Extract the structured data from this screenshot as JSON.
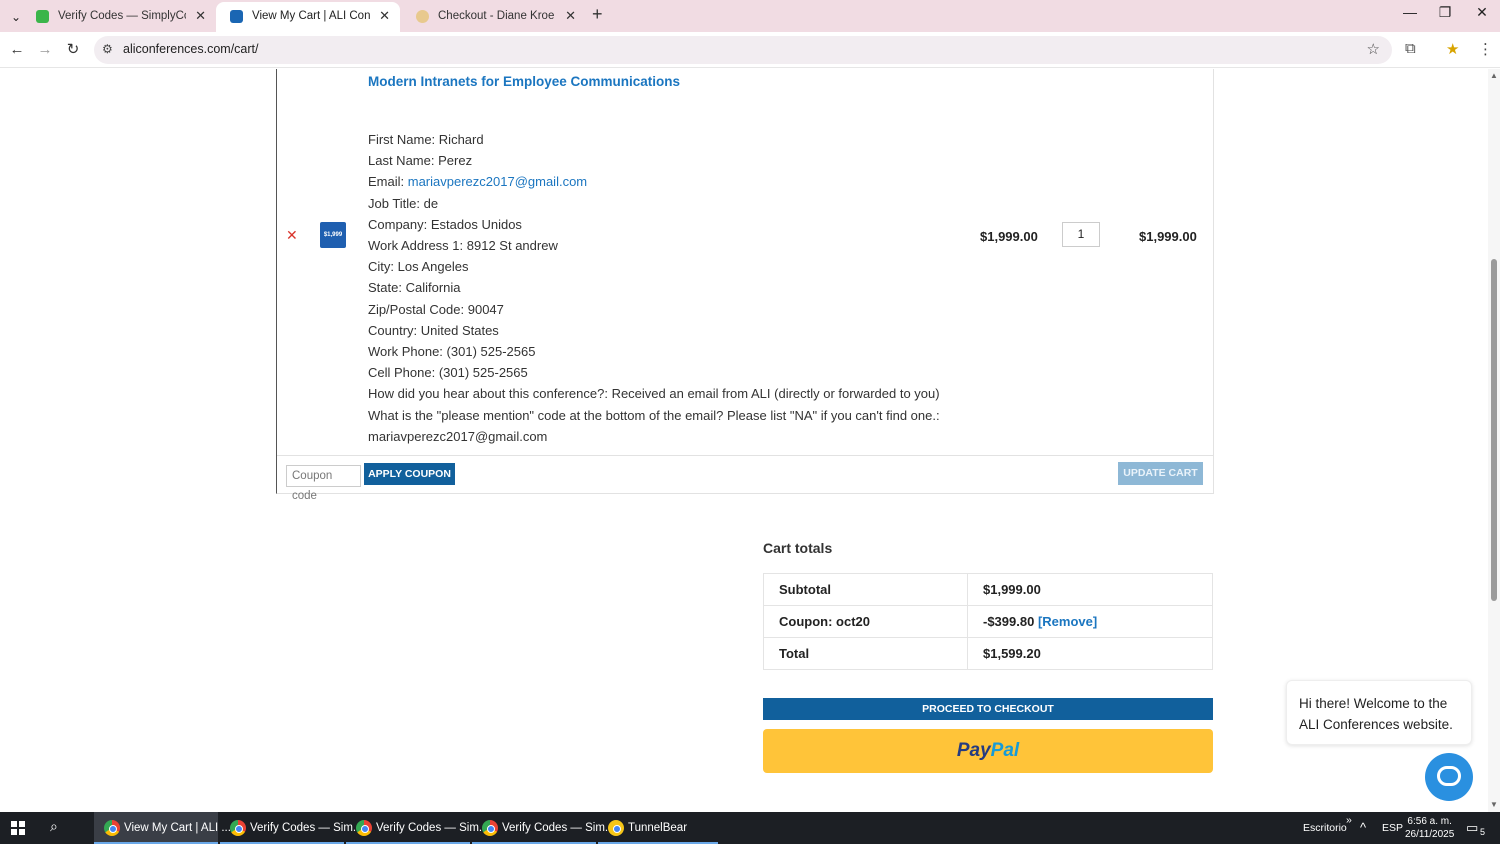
{
  "browser": {
    "tabs": [
      {
        "title": "Verify Codes — SimplyCodes",
        "active": false
      },
      {
        "title": "View My Cart | ALI Conferences",
        "active": true
      },
      {
        "title": "Checkout - Diane Kroe",
        "active": false
      }
    ],
    "url": "aliconferences.com/cart/"
  },
  "cart": {
    "item": {
      "thumb_label": "$1,999",
      "title": "Modern Intranets for Employee Communications",
      "fields": [
        {
          "label": "First Name:",
          "value": "Richard"
        },
        {
          "label": "Last Name:",
          "value": "Perez"
        },
        {
          "label": "Email:",
          "value": "mariavperezc2017@gmail.com",
          "link": true
        },
        {
          "label": "Job Title:",
          "value": "de"
        },
        {
          "label": "Company:",
          "value": "Estados Unidos"
        },
        {
          "label": "Work Address 1:",
          "value": "8912 St andrew"
        },
        {
          "label": "City:",
          "value": "Los Angeles"
        },
        {
          "label": "State:",
          "value": "California"
        },
        {
          "label": "Zip/Postal Code:",
          "value": "90047"
        },
        {
          "label": "Country:",
          "value": "United States"
        },
        {
          "label": "Work Phone:",
          "value": "(301) 525-2565"
        },
        {
          "label": "Cell Phone:",
          "value": "(301) 525-2565"
        },
        {
          "label": "How did you hear about this conference?:",
          "value": "Received an email from ALI (directly or forwarded to you)"
        },
        {
          "label": "What is the \"please mention\" code at the bottom of the email? Please list \"NA\" if you can't find one.:",
          "value": ""
        },
        {
          "label": "",
          "value": "mariavperezc2017@gmail.com"
        }
      ],
      "price": "$1,999.00",
      "quantity": "1",
      "subtotal": "$1,999.00"
    },
    "coupon_placeholder": "Coupon code",
    "apply_coupon_label": "APPLY COUPON",
    "update_cart_label": "UPDATE CART"
  },
  "totals": {
    "title": "Cart totals",
    "subtotal_label": "Subtotal",
    "subtotal_value": "$1,999.00",
    "coupon_label": "Coupon: oct20",
    "coupon_value": "-$399.80",
    "coupon_remove": "[Remove]",
    "total_label": "Total",
    "total_value": "$1,599.20",
    "checkout_label": "PROCEED TO CHECKOUT",
    "paypal_part1": "Pay",
    "paypal_part2": "Pal"
  },
  "chat": {
    "message": "Hi there! Welcome to the ALI Conferences website."
  },
  "taskbar": {
    "items": [
      {
        "label": "View My Cart | ALI ...",
        "active": true
      },
      {
        "label": "Verify Codes — Sim...",
        "active": false
      },
      {
        "label": "Verify Codes — Sim...",
        "active": false
      },
      {
        "label": "Verify Codes — Sim...",
        "active": false
      },
      {
        "label": "TunnelBear",
        "active": false
      }
    ],
    "desktop_label": "Escritorio",
    "language": "ESP",
    "time": "6:56 a. m.",
    "date": "26/11/2025",
    "notification_count": "5"
  }
}
